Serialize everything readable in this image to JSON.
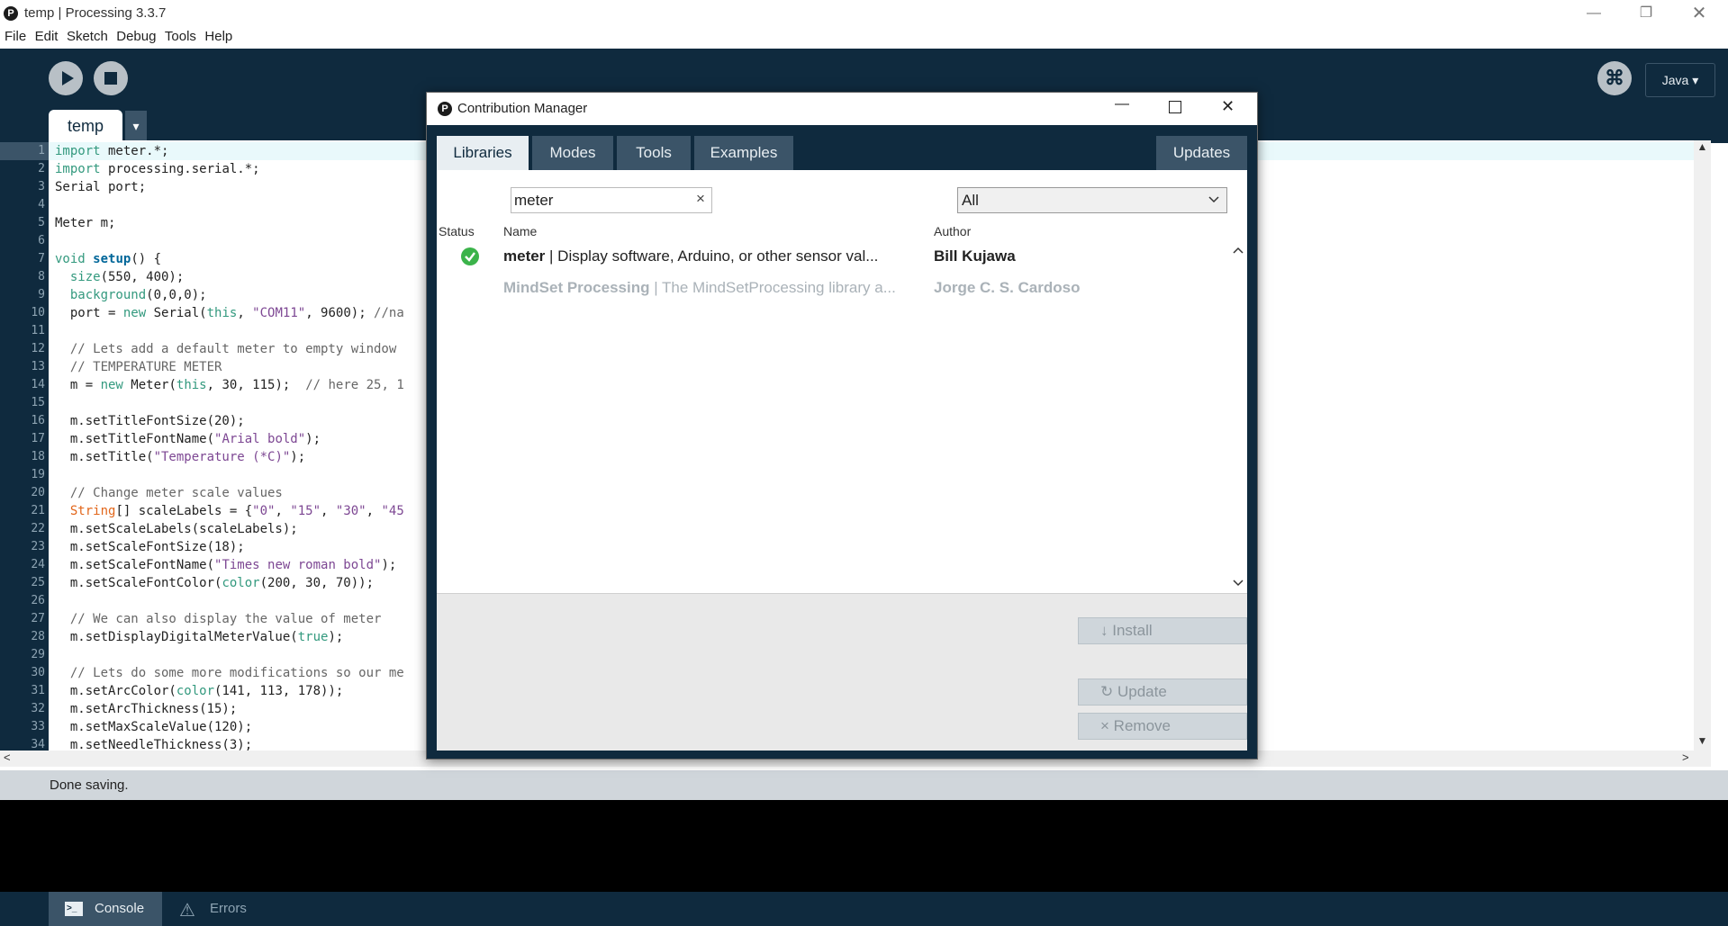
{
  "window": {
    "title": "temp | Processing 3.3.7",
    "logo": "P"
  },
  "menu": [
    "File",
    "Edit",
    "Sketch",
    "Debug",
    "Tools",
    "Help"
  ],
  "toolbar": {
    "mode": "Java ▾",
    "debug_glyph": "⌘"
  },
  "sketch_tab": {
    "label": "temp",
    "dropdown": "▾"
  },
  "code": [
    {
      "n": "1",
      "html": "<span class=\"kw\">import</span> meter.*;"
    },
    {
      "n": "2",
      "html": "<span class=\"kw\">import</span> processing.serial.*;"
    },
    {
      "n": "3",
      "html": "Serial port;"
    },
    {
      "n": "4",
      "html": ""
    },
    {
      "n": "5",
      "html": "Meter m;"
    },
    {
      "n": "6",
      "html": ""
    },
    {
      "n": "7",
      "html": "<span class=\"kw\">void</span> <span class=\"fn\">setup</span>() {"
    },
    {
      "n": "8",
      "html": "  <span class=\"kw\">size</span>(550, 400);"
    },
    {
      "n": "9",
      "html": "  <span class=\"kw\">background</span>(0,0,0);"
    },
    {
      "n": "10",
      "html": "  port = <span class=\"kw\">new</span> Serial(<span class=\"kw\">this</span>, <span class=\"st\">\"COM11\"</span>, 9600); <span class=\"cm\">//na</span>"
    },
    {
      "n": "11",
      "html": ""
    },
    {
      "n": "12",
      "html": "  <span class=\"cm\">// Lets add a default meter to empty window</span>"
    },
    {
      "n": "13",
      "html": "  <span class=\"cm\">// TEMPERATURE METER</span>"
    },
    {
      "n": "14",
      "html": "  m = <span class=\"kw\">new</span> Meter(<span class=\"kw\">this</span>, 30, 115);  <span class=\"cm\">// here 25, 1</span>"
    },
    {
      "n": "15",
      "html": ""
    },
    {
      "n": "16",
      "html": "  m.setTitleFontSize(20);"
    },
    {
      "n": "17",
      "html": "  m.setTitleFontName(<span class=\"st\">\"Arial bold\"</span>);"
    },
    {
      "n": "18",
      "html": "  m.setTitle(<span class=\"st\">\"Temperature (*C)\"</span>);"
    },
    {
      "n": "19",
      "html": ""
    },
    {
      "n": "20",
      "html": "  <span class=\"cm\">// Change meter scale values</span>"
    },
    {
      "n": "21",
      "html": "  <span class=\"ty\">String</span>[] scaleLabels = {<span class=\"st\">\"0\"</span>, <span class=\"st\">\"15\"</span>, <span class=\"st\">\"30\"</span>, <span class=\"st\">\"45</span>"
    },
    {
      "n": "22",
      "html": "  m.setScaleLabels(scaleLabels);"
    },
    {
      "n": "23",
      "html": "  m.setScaleFontSize(18);"
    },
    {
      "n": "24",
      "html": "  m.setScaleFontName(<span class=\"st\">\"Times new roman bold\"</span>);"
    },
    {
      "n": "25",
      "html": "  m.setScaleFontColor(<span class=\"kw\">color</span>(200, 30, 70));"
    },
    {
      "n": "26",
      "html": ""
    },
    {
      "n": "27",
      "html": "  <span class=\"cm\">// We can also display the value of meter</span>"
    },
    {
      "n": "28",
      "html": "  m.setDisplayDigitalMeterValue(<span class=\"kw\">true</span>);"
    },
    {
      "n": "29",
      "html": ""
    },
    {
      "n": "30",
      "html": "  <span class=\"cm\">// Lets do some more modifications so our me</span>"
    },
    {
      "n": "31",
      "html": "  m.setArcColor(<span class=\"kw\">color</span>(141, 113, 178));"
    },
    {
      "n": "32",
      "html": "  m.setArcThickness(15);"
    },
    {
      "n": "33",
      "html": "  m.setMaxScaleValue(120);"
    },
    {
      "n": "34",
      "html": "  m.setNeedleThickness(3);"
    }
  ],
  "status": {
    "message": "Done saving."
  },
  "footer": {
    "console": "Console",
    "errors": "Errors"
  },
  "dialog": {
    "title": "Contribution Manager",
    "logo": "P",
    "tabs": [
      "Libraries",
      "Modes",
      "Tools",
      "Examples"
    ],
    "updates_tab": "Updates",
    "search_value": "meter",
    "clear": "×",
    "filter": "All",
    "headers": {
      "status": "Status",
      "name": "Name",
      "author": "Author"
    },
    "rows": [
      {
        "name": "meter",
        "desc": " | Display software, Arduino, or other sensor val...",
        "author": "Bill  Kujawa",
        "installed": true
      },
      {
        "name": "MindSet Processing",
        "desc": " | The MindSetProcessing library a...",
        "author": "Jorge C. S. Cardoso",
        "installed": false
      }
    ],
    "buttons": {
      "install": "Install",
      "update": "Update",
      "remove": "Remove"
    },
    "button_icons": {
      "install": "↓",
      "update": "↻",
      "remove": "×"
    }
  }
}
